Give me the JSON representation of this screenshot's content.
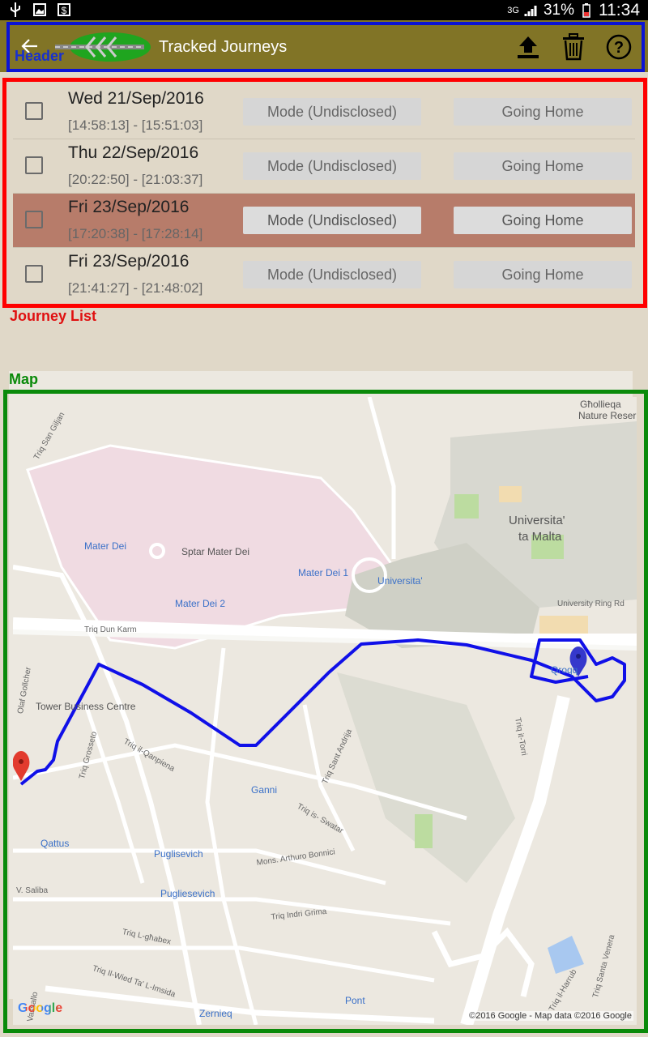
{
  "status_bar": {
    "network": "3G",
    "battery": "31%",
    "time": "11:34"
  },
  "header": {
    "title": "Tracked Journeys",
    "annotation": "Header"
  },
  "journey_list": {
    "annotation": "Journey List",
    "items": [
      {
        "date": "Wed 21/Sep/2016",
        "time_range": "[14:58:13] - [15:51:03]",
        "mode": "Mode (Undisclosed)",
        "purpose": "Going Home",
        "selected": false
      },
      {
        "date": "Thu 22/Sep/2016",
        "time_range": "[20:22:50] - [21:03:37]",
        "mode": "Mode (Undisclosed)",
        "purpose": "Going Home",
        "selected": false
      },
      {
        "date": "Fri 23/Sep/2016",
        "time_range": "[17:20:38] - [17:28:14]",
        "mode": "Mode (Undisclosed)",
        "purpose": "Going Home",
        "selected": true
      },
      {
        "date": "Fri 23/Sep/2016",
        "time_range": "[21:41:27] - [21:48:02]",
        "mode": "Mode (Undisclosed)",
        "purpose": "Going Home",
        "selected": false
      }
    ]
  },
  "map": {
    "annotation": "Map",
    "labels": {
      "ghollieqa": "Għollieqa",
      "nature_reserve": "Nature Reser",
      "triq_san_giljan": "Triq San Giljan",
      "mater_dei": "Mater Dei",
      "sptar_mater_dei": "Sptar Mater Dei",
      "universita_malta_1": "Universita'",
      "universita_malta_2": "ta Malta",
      "mater_dei_1": "Mater Dei 1",
      "universita_stop": "Universita'",
      "mater_dei_2": "Mater Dei 2",
      "university_ring_rd": "University Ring Rd",
      "triq_dun_karm": "Triq Dun Karm",
      "qroqq": "Qroqq",
      "olaf_gollcher": "Olaf Gollcher",
      "tower_business_centre": "Tower Business Centre",
      "triq_grosseto": "Triq Grosseto",
      "triq_il_qanpiena": "Triq il-Qanpiena",
      "triq_santandrija": "Triq Sant Andrija",
      "triq_xtorri": "Triq it-Torri",
      "ganni": "Ganni",
      "triq_is_swatar": "Triq is- Swatar",
      "qattus": "Qattus",
      "puglisevich": "Puglisevich",
      "mons_arthuro": "Mons. Arthuro Bonnici",
      "v_saliba": "V. Saliba",
      "pugliesevich": "Pugliesevich",
      "triq_indri_grima": "Triq Indri Grima",
      "triq_l_ghabex": "Triq L-għabex",
      "triq_il_wied": "Triq Il-Wied Ta' L-Imsida",
      "vassallo": "Vassallo",
      "zernieq": "Zernieq",
      "pont": "Pont",
      "triq_il_harrub": "Triq il-Harrub",
      "triq_santa_venera": "Triq Santa Venera"
    },
    "google": "Google",
    "copyright": "©2016 Google - Map data ©2016 Google",
    "route_color": "#1010e8"
  }
}
